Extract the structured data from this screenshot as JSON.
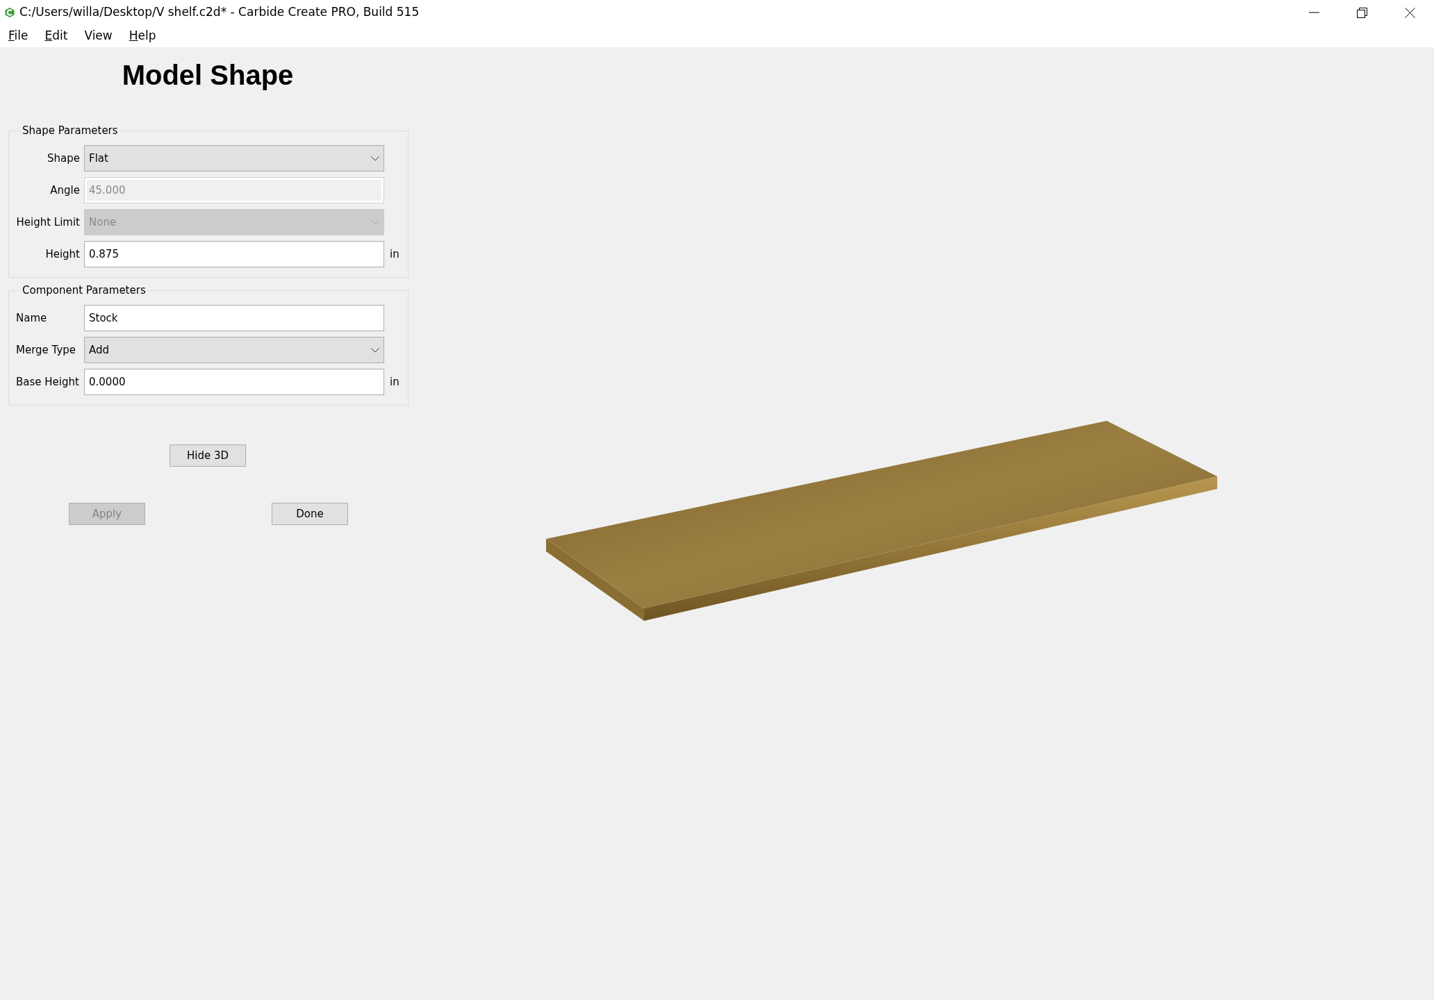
{
  "window": {
    "title": "C:/Users/willa/Desktop/V shelf.c2d* - Carbide Create PRO, Build 515"
  },
  "menu": [
    {
      "label": "File",
      "mnemonic": true
    },
    {
      "label": "Edit",
      "mnemonic": true
    },
    {
      "label": "View",
      "mnemonic": false
    },
    {
      "label": "Help",
      "mnemonic": true
    }
  ],
  "heading": "Model Shape",
  "groups": [
    {
      "title": "Shape Parameters",
      "fields": [
        {
          "label": "Shape",
          "kind": "dropdown",
          "value": "Flat",
          "disabled": false
        },
        {
          "label": "Angle",
          "kind": "text",
          "value": "45.000",
          "disabled": true
        },
        {
          "label": "Height Limit",
          "kind": "dropdown",
          "value": "None",
          "disabled": true
        },
        {
          "label": "Height",
          "kind": "text",
          "value": "0.875",
          "disabled": false,
          "unit": "in"
        }
      ]
    },
    {
      "title": "Component Parameters",
      "fields": [
        {
          "label": "Name",
          "kind": "text",
          "value": "Stock",
          "disabled": false
        },
        {
          "label": "Merge Type",
          "kind": "dropdown",
          "value": "Add",
          "disabled": false
        },
        {
          "label": "Base Height",
          "kind": "text",
          "value": "0.0000",
          "disabled": false,
          "unit": "in"
        }
      ]
    }
  ],
  "toggle_button": {
    "label": "Hide 3D",
    "disabled": false
  },
  "buttons": [
    {
      "label": "Apply",
      "disabled": true
    },
    {
      "label": "Done",
      "disabled": false
    }
  ]
}
